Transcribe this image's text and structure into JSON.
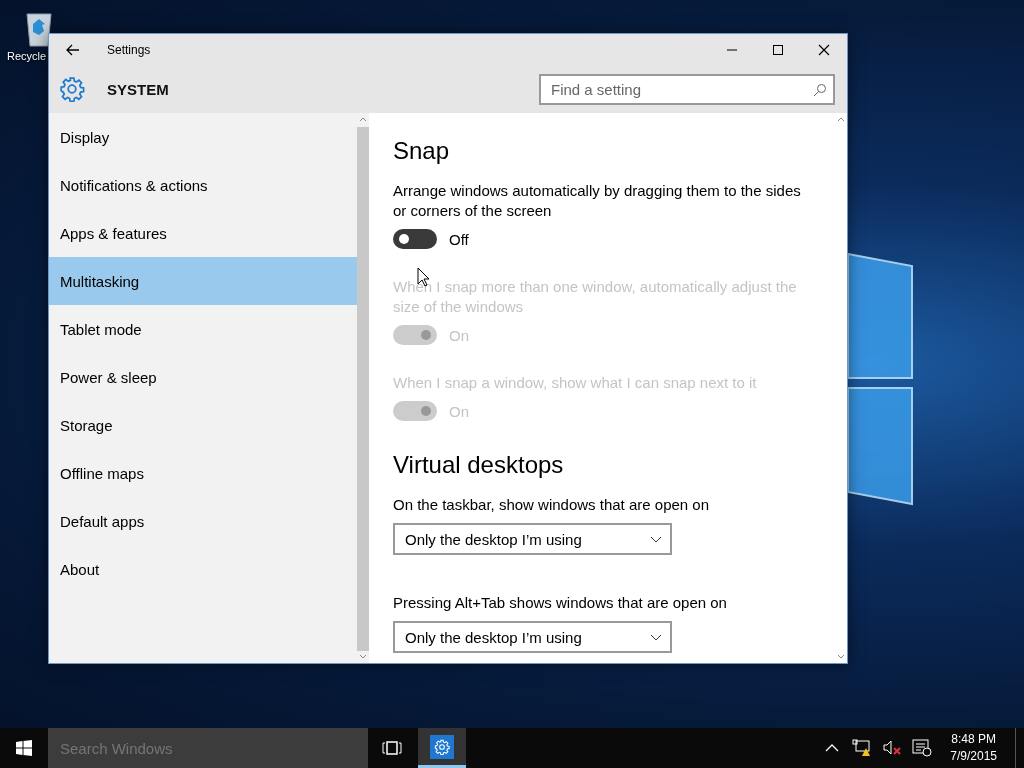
{
  "desktop_icons": [
    {
      "label": "Recycle"
    }
  ],
  "window": {
    "title": "Settings",
    "header": "SYSTEM",
    "search": {
      "placeholder": "Find a setting"
    }
  },
  "sidebar": {
    "items": [
      {
        "label": "Display",
        "selected": false
      },
      {
        "label": "Notifications & actions",
        "selected": false
      },
      {
        "label": "Apps & features",
        "selected": false
      },
      {
        "label": "Multitasking",
        "selected": true
      },
      {
        "label": "Tablet mode",
        "selected": false
      },
      {
        "label": "Power & sleep",
        "selected": false
      },
      {
        "label": "Storage",
        "selected": false
      },
      {
        "label": "Offline maps",
        "selected": false
      },
      {
        "label": "Default apps",
        "selected": false
      },
      {
        "label": "About",
        "selected": false
      }
    ]
  },
  "content": {
    "sections": [
      {
        "heading": "Snap",
        "settings": [
          {
            "kind": "toggle",
            "description": "Arrange windows automatically by dragging them to the sides or corners of the screen",
            "on": false,
            "disabled": false,
            "state_label": "Off"
          },
          {
            "kind": "toggle",
            "description": "When I snap more than one window, automatically adjust the size of the windows",
            "on": true,
            "disabled": true,
            "state_label": "On"
          },
          {
            "kind": "toggle",
            "description": "When I snap a window, show what I can snap next to it",
            "on": true,
            "disabled": true,
            "state_label": "On"
          }
        ]
      },
      {
        "heading": "Virtual desktops",
        "settings": [
          {
            "kind": "dropdown",
            "description": "On the taskbar, show windows that are open on",
            "value": "Only the desktop I’m using"
          },
          {
            "kind": "dropdown",
            "description": "Pressing Alt+Tab shows windows that are open on",
            "value": "Only the desktop I’m using"
          }
        ]
      }
    ]
  },
  "taskbar": {
    "search": {
      "placeholder": "Search Windows"
    },
    "time": "8:48 PM",
    "date": "7/9/2015"
  }
}
